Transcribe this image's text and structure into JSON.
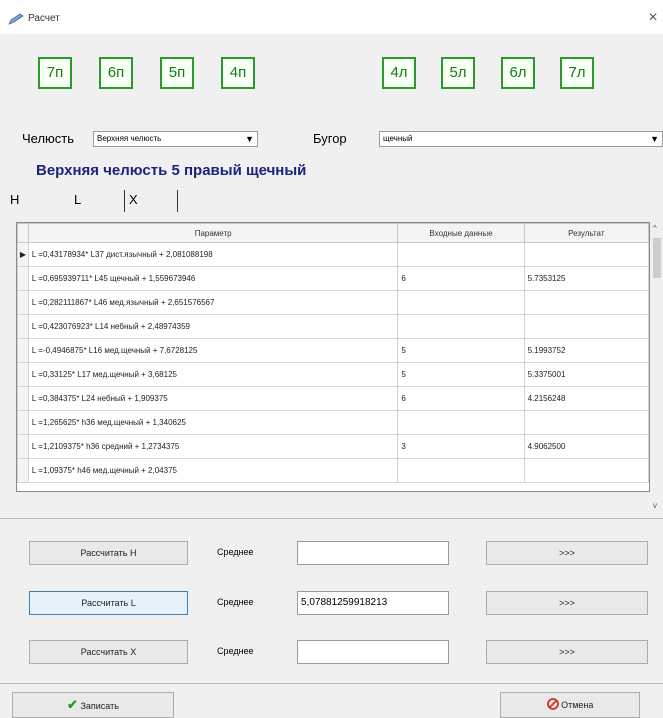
{
  "window": {
    "title": "Расчет",
    "close_symbol": "×"
  },
  "teeth_right": [
    "7п",
    "6п",
    "5п",
    "4п"
  ],
  "teeth_left": [
    "4л",
    "5л",
    "6л",
    "7л"
  ],
  "jaw_label": "Челюсть",
  "jaw_value": "Верхняя челюсть",
  "tubercle_label": "Бугор",
  "tubercle_value": "щечный",
  "heading": "Верхняя челюсть 5 правый щечный",
  "tabs": [
    "H",
    "L",
    "X"
  ],
  "table": {
    "headers": [
      "Параметр",
      "Входные данные",
      "Результат"
    ],
    "rows": [
      {
        "param": "L =0,43178934* L37 дист.язычный + 2,081088198",
        "input": "",
        "result": ""
      },
      {
        "param": "L =0,695939711* L45 щечный + 1,559673946",
        "input": "6",
        "result": "5.7353125"
      },
      {
        "param": "L =0,282111867* L46 мед.язычный + 2,651576567",
        "input": "",
        "result": ""
      },
      {
        "param": "L =0,423076923* L14 небный + 2,48974359",
        "input": "",
        "result": ""
      },
      {
        "param": "L =-0,4946875* L16 мед.щечный + 7,6728125",
        "input": "5",
        "result": "5.1993752"
      },
      {
        "param": "L =0,33125* L17 мед.щечный + 3,68125",
        "input": "5",
        "result": "5.3375001"
      },
      {
        "param": "L =0,384375* L24 небный + 1,909375",
        "input": "6",
        "result": "4.2156248"
      },
      {
        "param": "L =1,265625* h36 мед.щечный + 1,340625",
        "input": "",
        "result": ""
      },
      {
        "param": "L =1,2109375* h36 средний + 1,2734375",
        "input": "3",
        "result": "4.9062500"
      },
      {
        "param": "L =1,09375* h46 мед.щечный + 2,04375",
        "input": "",
        "result": ""
      }
    ]
  },
  "calc": [
    {
      "button": "Рассчитать H",
      "avg_label": "Среднее",
      "avg_value": "",
      "more": ">>>"
    },
    {
      "button": "Рассчитать L",
      "avg_label": "Среднее",
      "avg_value": "5,07881259918213",
      "more": ">>>"
    },
    {
      "button": "Рассчитать X",
      "avg_label": "Среднее",
      "avg_value": "",
      "more": ">>>"
    }
  ],
  "save_button": "Записать",
  "cancel_button": "Отмена",
  "colors": {
    "tooth_border": "#2a9a2a",
    "heading": "#1a237e",
    "save_icon": "#2a9a2a",
    "cancel_icon": "#d32f2f"
  }
}
